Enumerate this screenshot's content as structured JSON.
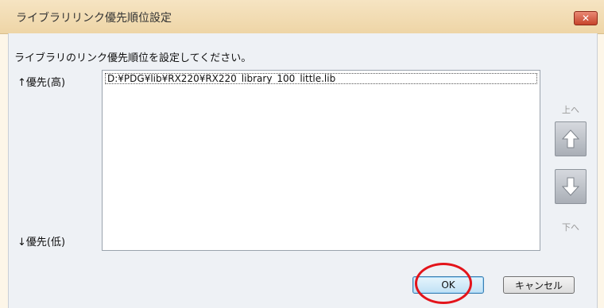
{
  "window": {
    "title": "ライブラリリンク優先順位設定",
    "close_glyph": "✕"
  },
  "dialog": {
    "instruction": "ライブラリのリンク優先順位を設定してください。",
    "priority_high_label": "↑優先(高)",
    "priority_low_label": "↓優先(低)"
  },
  "library_list": {
    "items": [
      "D:¥PDG¥lib¥RX220¥RX220_library_100_little.lib"
    ]
  },
  "side_buttons": {
    "up_label": "上へ",
    "down_label": "下へ",
    "up_icon": "arrow-up-icon",
    "down_icon": "arrow-down-icon"
  },
  "footer": {
    "ok_label": "OK",
    "cancel_label": "キャンセル"
  },
  "colors": {
    "title_bar": "#eed5a6",
    "client_bg": "#eef1f5",
    "highlight_circle": "#e3141b",
    "ok_button": "#bfe1f5"
  }
}
